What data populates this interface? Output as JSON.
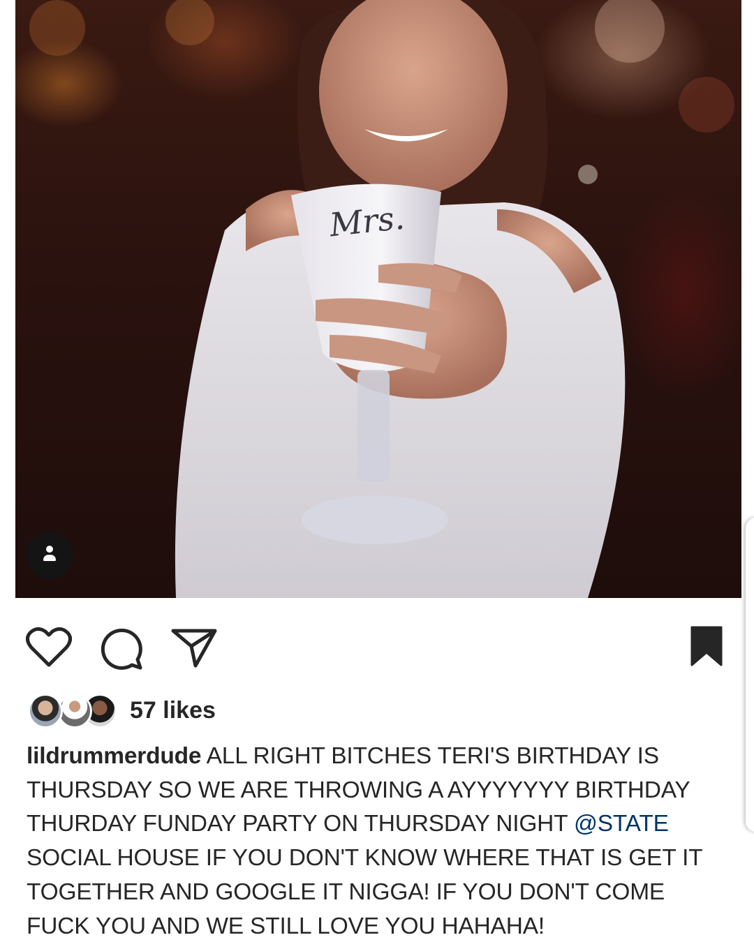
{
  "post": {
    "likes_text": "57 likes",
    "caption": {
      "username": "lildrummerdude",
      "text_before_mention": "ALL RIGHT BITCHES TERI'S BIRTHDAY IS THURSDAY SO WE ARE THROWING A AYYYYYYY BIRTHDAY THURDAY FUNDAY PARTY ON THURSDAY NIGHT",
      "mention": "@STATE",
      "text_after_mention": "SOCIAL HOUSE IF YOU DON'T KNOW WHERE THAT IS GET IT TOGETHER AND GOOGLE IT NIGGA! IF YOU DON'T COME FUCK YOU AND WE STILL LOVE YOU HAHAHA!"
    },
    "photo": {
      "cup_text": "Mrs."
    }
  },
  "icons": {
    "like": "heart-icon",
    "comment": "speech-bubble-icon",
    "share": "paper-plane-icon",
    "save": "bookmark-icon",
    "tag": "person-tag-icon"
  },
  "colors": {
    "text": "#262626",
    "mention": "#003569",
    "icon": "#262626"
  }
}
